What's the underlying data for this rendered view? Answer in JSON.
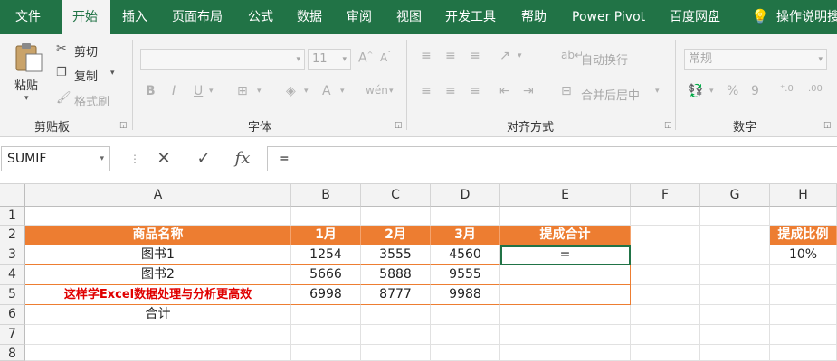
{
  "menu": {
    "tabs": [
      "文件",
      "开始",
      "插入",
      "页面布局",
      "公式",
      "数据",
      "审阅",
      "视图",
      "开发工具",
      "帮助",
      "Power Pivot",
      "百度网盘",
      "操作说明搜"
    ],
    "active": "开始"
  },
  "ribbon": {
    "clipboard": {
      "paste": "粘贴",
      "cut": "剪切",
      "copy": "复制",
      "format_painter": "格式刷",
      "label": "剪贴板"
    },
    "font": {
      "size_value": "11",
      "bold": "B",
      "italic": "I",
      "underline": "U",
      "label": "字体"
    },
    "alignment": {
      "wrap_text": "自动换行",
      "merge_center": "合并后居中",
      "label": "对齐方式"
    },
    "number": {
      "format_value": "常规",
      "percent": "%",
      "comma": "9",
      "label": "数字"
    }
  },
  "formula_bar": {
    "name_box": "SUMIF",
    "cancel": "✕",
    "enter": "✓",
    "fx": "fx",
    "formula": "="
  },
  "columns": [
    "A",
    "B",
    "C",
    "D",
    "E",
    "F",
    "G",
    "H"
  ],
  "rows": [
    "1",
    "2",
    "3",
    "4",
    "5",
    "6",
    "7",
    "8"
  ],
  "sheet": {
    "header": {
      "name": "商品名称",
      "m1": "1月",
      "m2": "2月",
      "m3": "3月",
      "total": "提成合计",
      "rate": "提成比例"
    },
    "rows": [
      {
        "name": "图书1",
        "m1": "1254",
        "m2": "3555",
        "m3": "4560",
        "total": "="
      },
      {
        "name": "图书2",
        "m1": "5666",
        "m2": "5888",
        "m3": "9555",
        "total": ""
      },
      {
        "name": "这样学Excel数据处理与分析更高效",
        "m1": "6998",
        "m2": "8777",
        "m3": "9988",
        "total": ""
      }
    ],
    "sum_label": "合计",
    "rate_value": "10%"
  },
  "colors": {
    "ribbon_green": "#217346",
    "header_orange": "#ed7d31",
    "highlight_red": "#e00000"
  }
}
